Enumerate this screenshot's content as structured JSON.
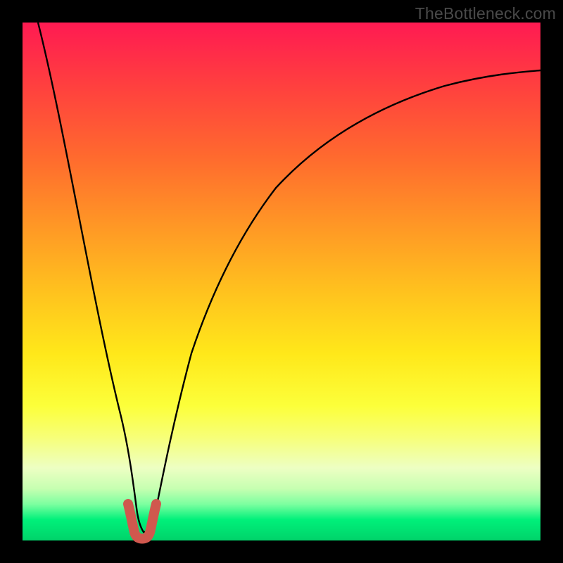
{
  "watermark": "TheBottleneck.com",
  "colors": {
    "frame": "#000000",
    "curve": "#000000",
    "marker": "#d0584e",
    "gradient_stops": [
      "#ff1a52",
      "#ff3f3f",
      "#ff6a2e",
      "#ff9326",
      "#ffc21e",
      "#ffe81a",
      "#fcff3a",
      "#f7ff77",
      "#edffc3",
      "#c6ffb1",
      "#7cffa0",
      "#00f07a",
      "#00d36a"
    ]
  },
  "chart_data": {
    "type": "line",
    "title": "",
    "xlabel": "",
    "ylabel": "",
    "xlim": [
      0,
      100
    ],
    "ylim": [
      0,
      100
    ],
    "grid": false,
    "legend": false,
    "series": [
      {
        "name": "bottleneck-curve",
        "x": [
          3,
          6,
          9,
          12,
          15,
          17,
          19,
          20,
          21,
          22,
          23,
          24,
          26,
          28,
          30,
          34,
          38,
          44,
          50,
          58,
          66,
          76,
          86,
          96,
          100
        ],
        "y": [
          100,
          85,
          70,
          55,
          40,
          27,
          15,
          8,
          3,
          1,
          1,
          3,
          10,
          20,
          30,
          45,
          56,
          66,
          73,
          79,
          83,
          86,
          88,
          89.5,
          90
        ]
      },
      {
        "name": "min-marker",
        "x": [
          20,
          21,
          22,
          23,
          24
        ],
        "y": [
          7,
          2,
          0.5,
          2,
          7
        ]
      }
    ],
    "minimum": {
      "x": 22,
      "y": 0.5
    }
  }
}
